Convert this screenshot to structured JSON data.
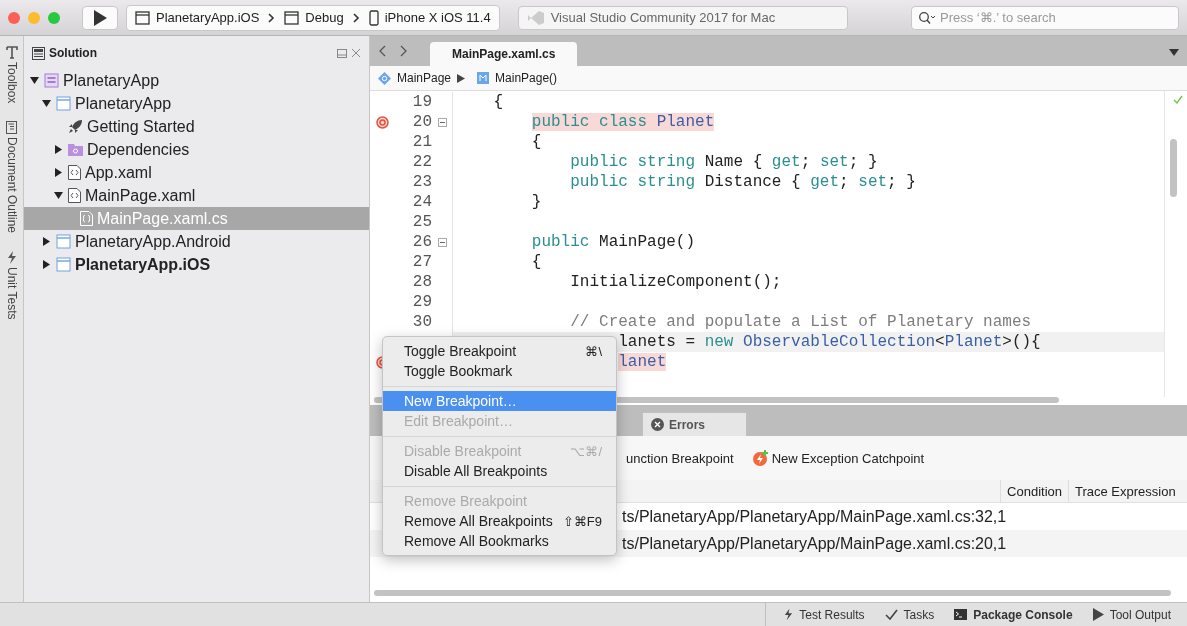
{
  "toolbar": {
    "config": [
      {
        "label": "PlanetaryApp.iOS",
        "kind": "window"
      },
      {
        "label": "Debug",
        "kind": "window"
      },
      {
        "label": "iPhone X iOS 11.4",
        "kind": "phone"
      }
    ],
    "status_text": "Visual Studio Community 2017 for Mac",
    "search": {
      "placeholder": "Press ‘⌘.’ to search"
    }
  },
  "side_strip": [
    {
      "label": "Toolbox",
      "kind": "toolbox"
    },
    {
      "label": "Document Outline",
      "kind": "outline"
    },
    {
      "label": "Unit Tests",
      "kind": "tests"
    }
  ],
  "solution": {
    "title": "Solution",
    "tree": [
      {
        "label": "PlanetaryApp",
        "kind": "solution",
        "expanded": true,
        "selected": false,
        "bold": false,
        "children": [
          {
            "label": "PlanetaryApp",
            "kind": "project",
            "expanded": true,
            "selected": false,
            "bold": false,
            "children": [
              {
                "label": "Getting Started",
                "kind": "rocket",
                "selected": false,
                "bold": false
              },
              {
                "label": "Dependencies",
                "kind": "folder",
                "expanded": false,
                "selected": false,
                "bold": false
              },
              {
                "label": "App.xaml",
                "kind": "xaml",
                "expanded": false,
                "selected": false,
                "bold": false
              },
              {
                "label": "MainPage.xaml",
                "kind": "xaml",
                "expanded": true,
                "selected": false,
                "bold": false,
                "children": [
                  {
                    "label": "MainPage.xaml.cs",
                    "kind": "cs",
                    "selected": true,
                    "bold": false
                  }
                ]
              }
            ]
          },
          {
            "label": "PlanetaryApp.Android",
            "kind": "project",
            "expanded": false,
            "selected": false,
            "bold": false
          },
          {
            "label": "PlanetaryApp.iOS",
            "kind": "project",
            "expanded": false,
            "selected": false,
            "bold": true
          }
        ]
      }
    ]
  },
  "editor": {
    "tabs": [
      {
        "label": "MainPage.xaml.cs",
        "selected": true
      }
    ],
    "breadcrumb": [
      {
        "label": "MainPage",
        "kind": "class"
      },
      {
        "label": "MainPage()",
        "kind": "method"
      }
    ],
    "lines": [
      {
        "number": "19",
        "breakpoint": false,
        "fold": false,
        "current": false,
        "segments": [
          {
            "t": "    {",
            "kind": "plain"
          }
        ]
      },
      {
        "number": "20",
        "breakpoint": true,
        "fold": true,
        "current": false,
        "segments": [
          {
            "t": "        public class ",
            "kind": "keyword",
            "hl": true
          },
          {
            "t": "Planet",
            "kind": "type",
            "hl": true
          }
        ]
      },
      {
        "number": "21",
        "breakpoint": false,
        "fold": false,
        "current": false,
        "segments": [
          {
            "t": "        {",
            "kind": "plain"
          }
        ]
      },
      {
        "number": "22",
        "breakpoint": false,
        "fold": false,
        "current": false,
        "segments": [
          {
            "t": "            public string ",
            "kind": "keyword"
          },
          {
            "t": "Name { ",
            "kind": "plain"
          },
          {
            "t": "get",
            "kind": "keyword"
          },
          {
            "t": "; ",
            "kind": "plain"
          },
          {
            "t": "set",
            "kind": "keyword"
          },
          {
            "t": "; }",
            "kind": "plain"
          }
        ]
      },
      {
        "number": "23",
        "breakpoint": false,
        "fold": false,
        "current": false,
        "segments": [
          {
            "t": "            public string ",
            "kind": "keyword"
          },
          {
            "t": "Distance { ",
            "kind": "plain"
          },
          {
            "t": "get",
            "kind": "keyword"
          },
          {
            "t": "; ",
            "kind": "plain"
          },
          {
            "t": "set",
            "kind": "keyword"
          },
          {
            "t": "; }",
            "kind": "plain"
          }
        ]
      },
      {
        "number": "24",
        "breakpoint": false,
        "fold": false,
        "current": false,
        "segments": [
          {
            "t": "        }",
            "kind": "plain"
          }
        ]
      },
      {
        "number": "25",
        "breakpoint": false,
        "fold": false,
        "current": false
      },
      {
        "number": "26",
        "breakpoint": false,
        "fold": true,
        "current": false,
        "segments": [
          {
            "t": "        public ",
            "kind": "keyword"
          },
          {
            "t": "MainPage()",
            "kind": "plain"
          }
        ]
      },
      {
        "number": "27",
        "breakpoint": false,
        "fold": false,
        "current": false,
        "segments": [
          {
            "t": "        {",
            "kind": "plain"
          }
        ]
      },
      {
        "number": "28",
        "breakpoint": false,
        "fold": false,
        "current": false,
        "segments": [
          {
            "t": "            InitializeComponent();",
            "kind": "plain"
          }
        ]
      },
      {
        "number": "29",
        "breakpoint": false,
        "fold": false,
        "current": false
      },
      {
        "number": "30",
        "breakpoint": false,
        "fold": false,
        "current": false,
        "segments": [
          {
            "t": "            // Create and populate a List of Planetary names",
            "kind": "comment"
          }
        ]
      },
      {
        "breakpoint": false,
        "fold": false,
        "current": true,
        "segments": [
          {
            "t": "                 lanets = ",
            "kind": "plain"
          },
          {
            "t": "new ",
            "kind": "keyword"
          },
          {
            "t": "ObservableCollection",
            "kind": "type"
          },
          {
            "t": "<",
            "kind": "plain"
          },
          {
            "t": "Planet",
            "kind": "type"
          },
          {
            "t": ">(){",
            "kind": "plain"
          }
        ]
      },
      {
        "breakpoint": true,
        "fold": false,
        "current": false,
        "segments": [
          {
            "t": "                 lanet",
            "kind": "type",
            "hl": true
          }
        ]
      }
    ]
  },
  "pad": {
    "tabs": [
      {
        "label": "Errors",
        "kind": "errors",
        "selected": false
      }
    ],
    "actions": [
      {
        "label": "unction Breakpoint",
        "kind": "plain"
      },
      {
        "label": "New Exception Catchpoint",
        "kind": "exception"
      }
    ],
    "columns": [
      "Condition",
      "Trace Expression"
    ],
    "rows": [
      {
        "location": "ts/PlanetaryApp/PlanetaryApp/MainPage.xaml.cs:32,1"
      },
      {
        "location": "ts/PlanetaryApp/PlanetaryApp/MainPage.xaml.cs:20,1"
      }
    ]
  },
  "context_menu": [
    {
      "kind": "item",
      "label": "Toggle Breakpoint",
      "shortcut": "⌘\\",
      "disabled": false,
      "selected": false
    },
    {
      "kind": "item",
      "label": "Toggle Bookmark",
      "disabled": false,
      "selected": false
    },
    {
      "kind": "separator"
    },
    {
      "kind": "item",
      "label": "New Breakpoint…",
      "disabled": false,
      "selected": true
    },
    {
      "kind": "item",
      "label": "Edit Breakpoint…",
      "disabled": true,
      "selected": false
    },
    {
      "kind": "separator"
    },
    {
      "kind": "item",
      "label": "Disable Breakpoint",
      "shortcut": "⌥⌘/",
      "disabled": true,
      "selected": false
    },
    {
      "kind": "item",
      "label": "Disable All Breakpoints",
      "disabled": false,
      "selected": false
    },
    {
      "kind": "separator"
    },
    {
      "kind": "item",
      "label": "Remove Breakpoint",
      "disabled": true,
      "selected": false
    },
    {
      "kind": "item",
      "label": "Remove All Breakpoints",
      "shortcut": "⇧⌘F9",
      "disabled": false,
      "selected": false
    },
    {
      "kind": "item",
      "label": "Remove All Bookmarks",
      "disabled": false,
      "selected": false
    }
  ],
  "status_bar": [
    {
      "label": "Test Results",
      "kind": "tests",
      "bold": false
    },
    {
      "label": "Tasks",
      "kind": "tasks",
      "bold": false
    },
    {
      "label": "Package Console",
      "kind": "console",
      "bold": true
    },
    {
      "label": "Tool Output",
      "kind": "output",
      "bold": false
    }
  ]
}
